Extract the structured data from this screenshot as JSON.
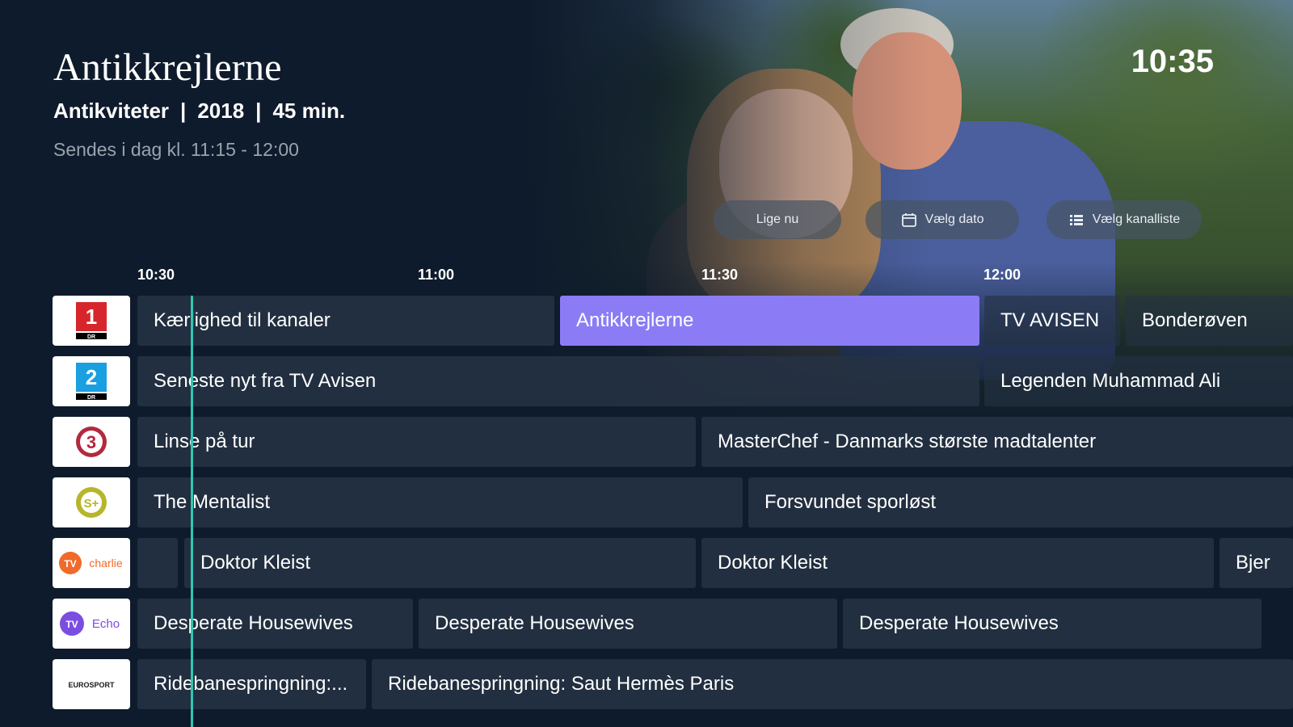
{
  "program": {
    "title": "Antikkrejlerne",
    "genre": "Antikviteter",
    "year": "2018",
    "duration": "45 min.",
    "separator": "|",
    "airtime": "Sendes i dag kl. 11:15 - 12:00"
  },
  "clock": "10:35",
  "actions": {
    "now": "Lige nu",
    "date": "Vælg dato",
    "channel_list": "Vælg kanalliste"
  },
  "timeline": [
    "10:30",
    "11:00",
    "11:30",
    "12:00"
  ],
  "channels": [
    {
      "logo_text": "1",
      "logo_sub": "DR",
      "color": "#d7262b",
      "programs": [
        "Kærlighed til kanaler",
        "Antikkrejlerne",
        "TV AVISEN",
        "Bonderøven"
      ]
    },
    {
      "logo_text": "2",
      "logo_sub": "DR",
      "color": "#1a9fe0",
      "programs": [
        "Seneste nyt fra TV Avisen",
        "Legenden Muhammad Ali"
      ]
    },
    {
      "logo_text": "3",
      "color": "#b22a3e",
      "programs": [
        "Linse på tur",
        "MasterChef - Danmarks største madtalenter"
      ]
    },
    {
      "logo_text": "S+",
      "color": "#b7b52a",
      "programs": [
        "The Mentalist",
        "Forsvundet sporløst"
      ]
    },
    {
      "logo_text": "charlie",
      "color": "#f06a2c",
      "programs": [
        "",
        "Doktor Kleist",
        "Doktor Kleist",
        "Bjer"
      ]
    },
    {
      "logo_text": "Echo",
      "color": "#7b4de0",
      "programs": [
        "Desperate Housewives",
        "Desperate Housewives",
        "Desperate Housewives"
      ]
    },
    {
      "logo_text": "EUROSPORT",
      "color": "#1a1a1a",
      "programs": [
        "Ridebanespringning:...",
        "Ridebanespringning: Saut Hermès Paris"
      ]
    }
  ]
}
